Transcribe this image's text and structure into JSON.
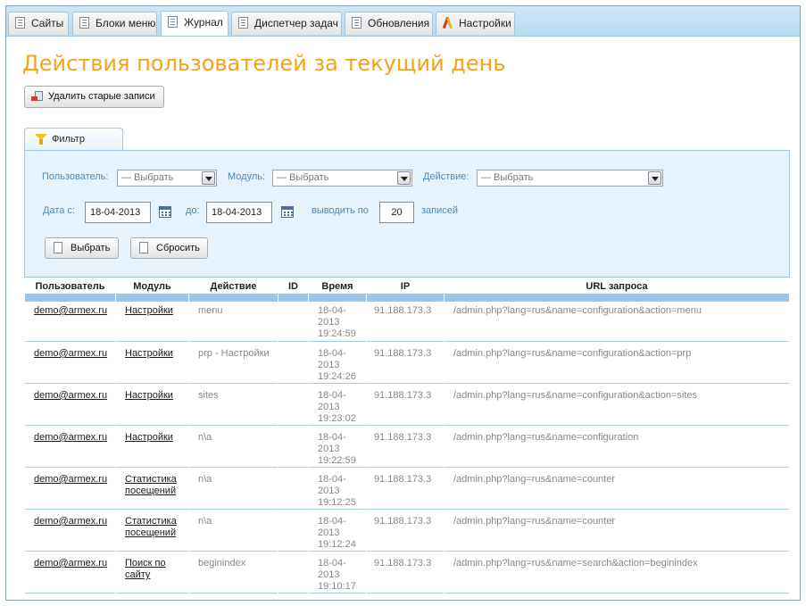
{
  "tabs": [
    {
      "label": "Сайты",
      "icon": "page-icon"
    },
    {
      "label": "Блоки меню",
      "icon": "page-icon"
    },
    {
      "label": "Журнал",
      "icon": "page-icon",
      "active": true
    },
    {
      "label": "Диспетчер задач",
      "icon": "page-icon"
    },
    {
      "label": "Обновления",
      "icon": "page-icon"
    },
    {
      "label": "Настройки",
      "icon": "tools-icon"
    }
  ],
  "page_title": "Действия пользователей за текущий день",
  "delete_button": "Удалить старые записи",
  "filter": {
    "tab_label": "Фильтр",
    "user_label": "Пользователь:",
    "user_value": "— Выбрать",
    "module_label": "Модуль:",
    "module_value": "— Выбрать",
    "action_label": "Действие:",
    "action_value": "— Выбрать",
    "date_from_label": "Дата с:",
    "date_from": "18-04-2013",
    "date_to_label": "до:",
    "date_to": "18-04-2013",
    "per_page_label": "выводить по",
    "per_page": "20",
    "records_label": "записей",
    "apply_button": "Выбрать",
    "reset_button": "Сбросить"
  },
  "table": {
    "headers": [
      "Пользователь",
      "Модуль",
      "Действие",
      "ID",
      "Время",
      "IP",
      "URL запроса"
    ],
    "rows": [
      {
        "user": "demo@armex.ru",
        "module": "Настройки",
        "action": "menu",
        "id": "",
        "date": "18-04-2013",
        "time": "19:24:59",
        "ip": "91.188.173.3",
        "url": "/admin.php?lang=rus&name=configuration&action=menu"
      },
      {
        "user": "demo@armex.ru",
        "module": "Настройки",
        "action": "prp - Настройки",
        "id": "",
        "date": "18-04-2013",
        "time": "19:24:26",
        "ip": "91.188.173.3",
        "url": "/admin.php?lang=rus&name=configuration&action=prp"
      },
      {
        "user": "demo@armex.ru",
        "module": "Настройки",
        "action": "sites",
        "id": "",
        "date": "18-04-2013",
        "time": "19:23:02",
        "ip": "91.188.173.3",
        "url": "/admin.php?lang=rus&name=configuration&action=sites"
      },
      {
        "user": "demo@armex.ru",
        "module": "Настройки",
        "action": "n\\a",
        "id": "",
        "date": "18-04-2013",
        "time": "19:22:59",
        "ip": "91.188.173.3",
        "url": "/admin.php?lang=rus&name=configuration"
      },
      {
        "user": "demo@armex.ru",
        "module": "Статистика посещений",
        "action": "n\\a",
        "id": "",
        "date": "18-04-2013",
        "time": "19:12:25",
        "ip": "91.188.173.3",
        "url": "/admin.php?lang=rus&name=counter"
      },
      {
        "user": "demo@armex.ru",
        "module": "Статистика посещений",
        "action": "n\\a",
        "id": "",
        "date": "18-04-2013",
        "time": "19:12:24",
        "ip": "91.188.173.3",
        "url": "/admin.php?lang=rus&name=counter"
      },
      {
        "user": "demo@armex.ru",
        "module": "Поиск по сайту",
        "action": "beginindex",
        "id": "",
        "date": "18-04-2013",
        "time": "19:10:17",
        "ip": "91.188.173.3",
        "url": "/admin.php?lang=rus&name=search&action=beginindex"
      }
    ]
  },
  "colors": {
    "title": "#f7a11a",
    "label": "#4f87b8",
    "panel": "#e7f3fc",
    "table_header_bar": "#99c7eb"
  }
}
